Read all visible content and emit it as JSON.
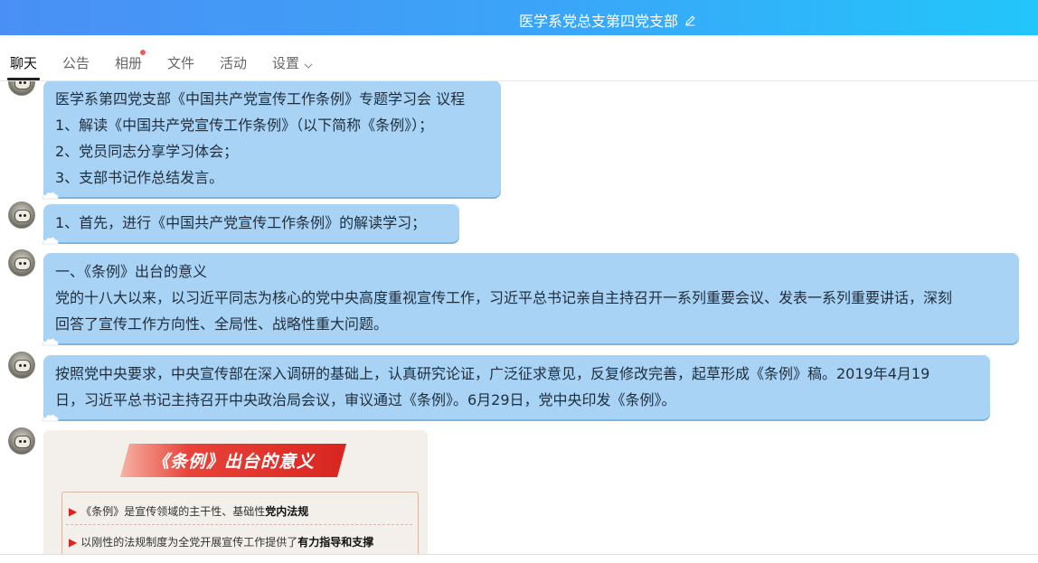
{
  "window": {
    "title": "医学系党总支第四党支部",
    "edit_icon": "edit-pencil-icon"
  },
  "tabs": [
    {
      "label": "聊天",
      "active": true
    },
    {
      "label": "公告"
    },
    {
      "label": "相册",
      "badge": "red-dot"
    },
    {
      "label": "文件"
    },
    {
      "label": "活动"
    },
    {
      "label": "设置",
      "icon": "chevron-down-icon"
    }
  ],
  "messages": [
    {
      "lines": [
        "医学系第四党支部《中国共产党宣传工作条例》专题学习会 议程",
        "1、解读《中国共产党宣传工作条例》（以下简称《条例》）；",
        "2、党员同志分享学习体会；",
        "3、支部书记作总结发言。"
      ]
    },
    {
      "lines": [
        "1、首先，进行《中国共产党宣传工作条例》的解读学习；"
      ]
    },
    {
      "lines": [
        "一、《条例》出台的意义",
        "党的十八大以来，以习近平同志为核心的党中央高度重视宣传工作，习近平总书记亲自主持召开一系列重要会议、发表一系列重要讲话，深刻",
        "回答了宣传工作方向性、全局性、战略性重大问题。"
      ]
    },
    {
      "lines": [
        "按照党中央要求，中央宣传部在深入调研的基础上，认真研究论证，广泛征求意见，反复修改完善，起草形成《条例》稿。2019年4月19",
        "日，习近平总书记主持召开中央政治局会议，审议通过《条例》。6月29日，党中央印发《条例》。"
      ]
    }
  ],
  "image_message": {
    "banner": "《条例》出台的意义",
    "bullets": [
      {
        "text": "《条例》是宣传领域的主干性、基础性",
        "bold": "党内法规"
      },
      {
        "text": "以刚性的法规制度为全党开展宣传工作提供了",
        "bold": "有力指导和支撑"
      }
    ],
    "bullet_marker": "▶"
  },
  "colors": {
    "bubble": "#a9d3f4",
    "header_start": "#4a8ff5",
    "header_end": "#22c6fb",
    "badge": "#f05a5a",
    "banner_red": "#d9251f"
  }
}
